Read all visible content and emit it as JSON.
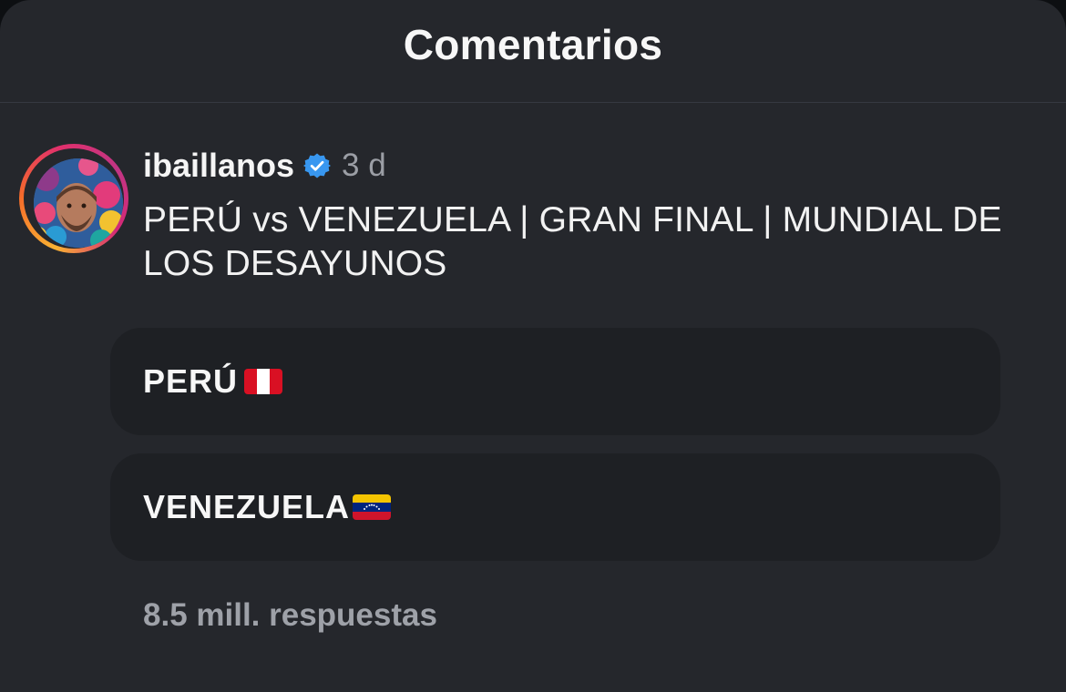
{
  "header": {
    "title": "Comentarios"
  },
  "post": {
    "username": "ibaillanos",
    "verified": true,
    "timestamp": "3 d",
    "text": "PERÚ vs VENEZUELA | GRAN FINAL | MUNDIAL DE LOS DESAYUNOS"
  },
  "poll": {
    "options": [
      {
        "label": "PERÚ",
        "flag_icon": "peru-flag-icon"
      },
      {
        "label": "VENEZUELA",
        "flag_icon": "venezuela-flag-icon"
      }
    ]
  },
  "replies": {
    "label": "8.5 mill. respuestas"
  },
  "colors": {
    "background": "#25272c",
    "option_background": "#1e2024",
    "verified_blue": "#3897f0",
    "muted_text": "#9ea1a8"
  }
}
